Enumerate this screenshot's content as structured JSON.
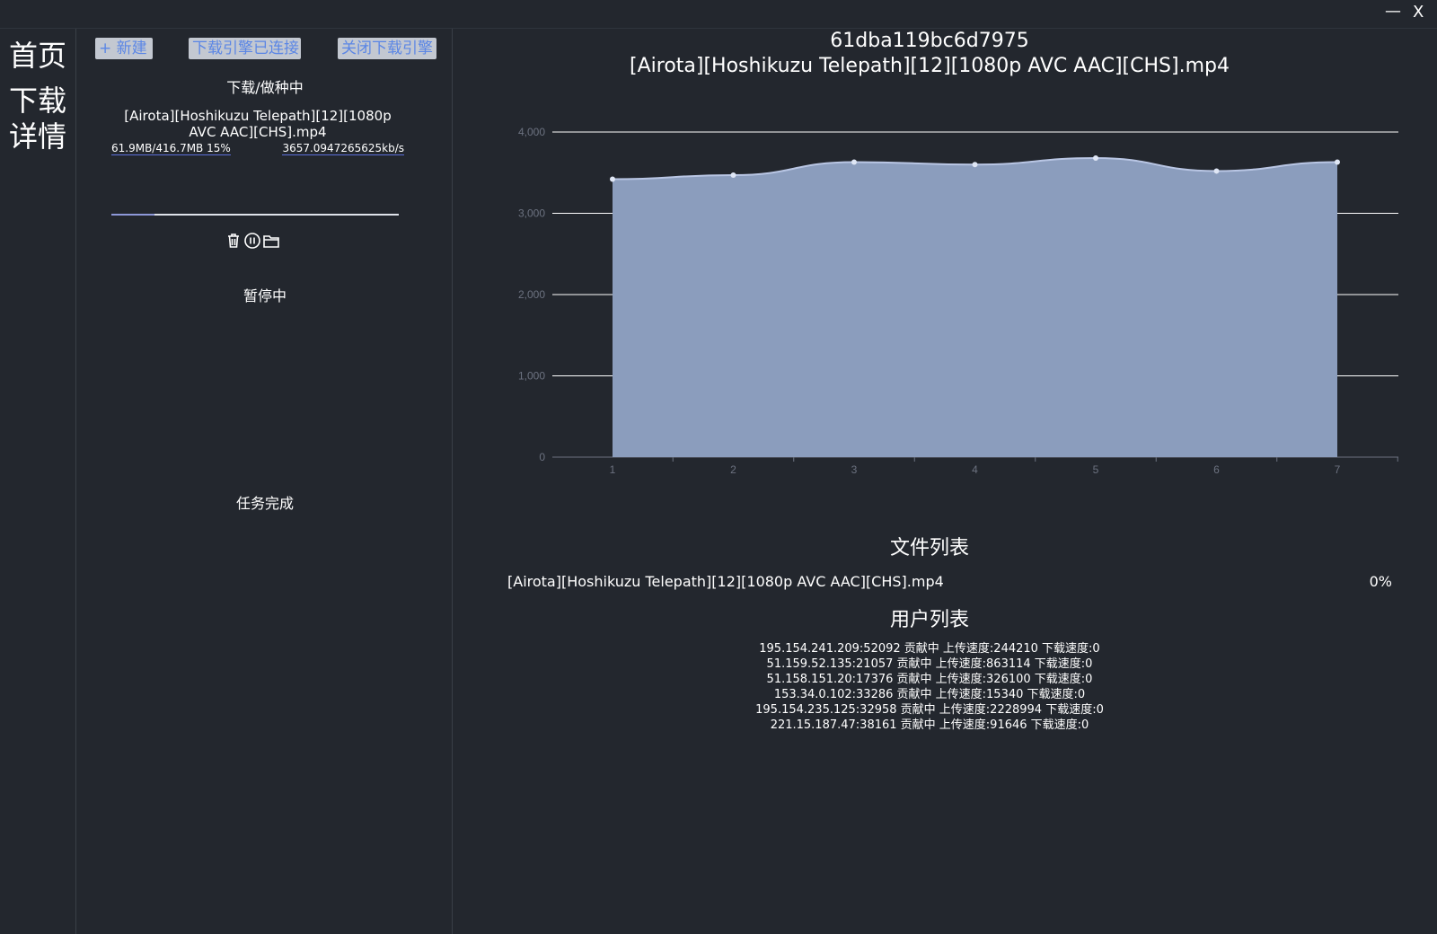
{
  "window": {
    "minimize": "—",
    "close": "X"
  },
  "nav": {
    "home": "首页",
    "detail": "下载详情"
  },
  "toolbar": {
    "new_label": "+ 新建",
    "engine_status": "下载引擎已连接",
    "close_engine": "关闭下载引擎"
  },
  "sections": {
    "active": "下载/做种中",
    "paused": "暂停中",
    "done": "任务完成"
  },
  "task": {
    "name": "[Airota][Hoshikuzu Telepath][12][1080p AVC AAC][CHS].mp4",
    "size": "61.9MB/416.7MB 15%",
    "speed": "3657.0947265625kb/s",
    "progress": 0.15,
    "actions": [
      "trash-icon",
      "pause-icon",
      "folder-icon"
    ]
  },
  "detail": {
    "hash": "61dba119bc6d7975",
    "title": "[Airota][Hoshikuzu Telepath][12][1080p AVC AAC][CHS].mp4",
    "files_title": "文件列表",
    "users_title": "用户列表",
    "files": [
      {
        "name": "[Airota][Hoshikuzu Telepath][12][1080p AVC AAC][CHS].mp4",
        "progress": "0%"
      }
    ],
    "peers": [
      "195.154.241.209:52092 贡献中 上传速度:244210 下载速度:0",
      "51.159.52.135:21057 贡献中 上传速度:863114 下载速度:0",
      "51.158.151.20:17376 贡献中 上传速度:326100 下载速度:0",
      "153.34.0.102:33286 贡献中 上传速度:15340 下载速度:0",
      "195.154.235.125:32958 贡献中 上传速度:2228994 下载速度:0",
      "221.15.187.47:38161 贡献中 上传速度:91646 下载速度:0"
    ]
  },
  "colors": {
    "background": "#23272e",
    "area_fill": "#8b9dbd",
    "line": "#b9c6e4",
    "accent": "#5b86e5"
  },
  "chart_data": {
    "type": "area",
    "x": [
      1,
      2,
      3,
      4,
      5,
      6,
      7
    ],
    "values": [
      3420,
      3470,
      3630,
      3600,
      3680,
      3520,
      3630
    ],
    "ylim": [
      0,
      4000
    ],
    "yticks": [
      "0",
      "1,000",
      "2,000",
      "3,000",
      "4,000"
    ],
    "grid": true,
    "title": "",
    "xlabel": "",
    "ylabel": ""
  }
}
